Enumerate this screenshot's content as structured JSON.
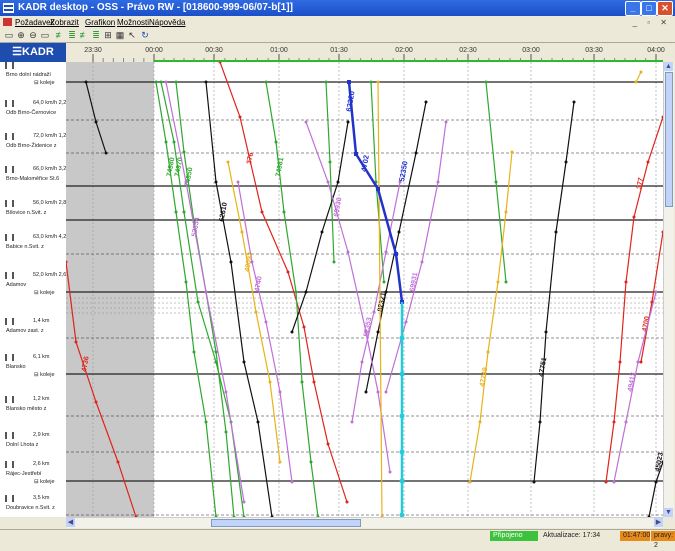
{
  "title_bar": {
    "title": "KADR desktop - OSS - Právo RW - [018600-999-06/07-b[1]]"
  },
  "menu": {
    "items": [
      "Požadavek",
      "Zobrazit",
      "Grafikon",
      "Možnosti",
      "Nápověda"
    ]
  },
  "logo": {
    "text": "KADR"
  },
  "timeline": {
    "labels": [
      "23:30",
      "00:00",
      "00:30",
      "01:00",
      "01:30",
      "02:00",
      "02:30",
      "03:00",
      "03:30",
      "04:00"
    ]
  },
  "stations": [
    {
      "name": "Brno dolní nádraží",
      "distance": "",
      "tracks": "koleje"
    },
    {
      "name": "Odb Brno-Černovice",
      "distance": "64,0 km/h 2,2 km",
      "tracks": ""
    },
    {
      "name": "Odb Brno-Židenice z",
      "distance": "72,0 km/h 1,2 km",
      "tracks": ""
    },
    {
      "name": "Brno-Maloměřice St.6",
      "distance": "66,0 km/h 3,2 km",
      "tracks": ""
    },
    {
      "name": "Bílovice n.Svit. z",
      "distance": "56,0 km/h 2,8 km",
      "tracks": ""
    },
    {
      "name": "Babice n.Svit. z",
      "distance": "63,0 km/h 4,2 km",
      "tracks": ""
    },
    {
      "name": "Adamov",
      "distance": "52,0 km/h 2,6 km",
      "tracks": "koleje"
    },
    {
      "name": "Adamov zast. z",
      "distance": "1,4 km",
      "tracks": ""
    },
    {
      "name": "Blansko",
      "distance": "6,1 km",
      "tracks": "koleje"
    },
    {
      "name": "Blansko město z",
      "distance": "1,2 km",
      "tracks": ""
    },
    {
      "name": "Dolní Lhota z",
      "distance": "2,9 km",
      "tracks": ""
    },
    {
      "name": "Rájec-Jestřebí",
      "distance": "2,6 km",
      "tracks": "koleje"
    },
    {
      "name": "Doubravice n.Svit. z",
      "distance": "3,5 km",
      "tracks": ""
    }
  ],
  "trains": [
    {
      "number": "4736",
      "color": "#E0241B"
    },
    {
      "number": "376",
      "color": "#E0241B"
    },
    {
      "number": "377",
      "color": "#E0241B"
    },
    {
      "number": "4700",
      "color": "#E0241B"
    },
    {
      "number": "74980",
      "color": "#2EA82E"
    },
    {
      "number": "74970",
      "color": "#2EA82E"
    },
    {
      "number": "74950",
      "color": "#2EA82E"
    },
    {
      "number": "74981",
      "color": "#2EA82E"
    },
    {
      "number": "62610",
      "color": "#111111"
    },
    {
      "number": "82321",
      "color": "#111111"
    },
    {
      "number": "47751",
      "color": "#111111"
    },
    {
      "number": "45023",
      "color": "#111111"
    },
    {
      "number": "52354",
      "color": "#C070D8"
    },
    {
      "number": "4740",
      "color": "#C070D8"
    },
    {
      "number": "69930",
      "color": "#C070D8"
    },
    {
      "number": "52353",
      "color": "#C070D8"
    },
    {
      "number": "69931",
      "color": "#C070D8"
    },
    {
      "number": "49413",
      "color": "#C070D8"
    },
    {
      "number": "40092",
      "color": "#E8B21A"
    },
    {
      "number": "47749",
      "color": "#E8B21A"
    },
    {
      "number": "62320",
      "color": "#2233CC"
    },
    {
      "number": "4702",
      "color": "#2233CC"
    },
    {
      "number": "52350",
      "color": "#2233CC"
    }
  ],
  "status": {
    "connected": "Připojeno",
    "update": "Aktualizace: 17:34",
    "time": "01:47:00",
    "changes": "pravy: 2"
  },
  "colors": {
    "red": "#E0241B",
    "green": "#2EA82E",
    "black": "#111111",
    "violet": "#C070D8",
    "yellow": "#E8B21A",
    "blue": "#2233CC",
    "cyan": "#22CCDD"
  }
}
